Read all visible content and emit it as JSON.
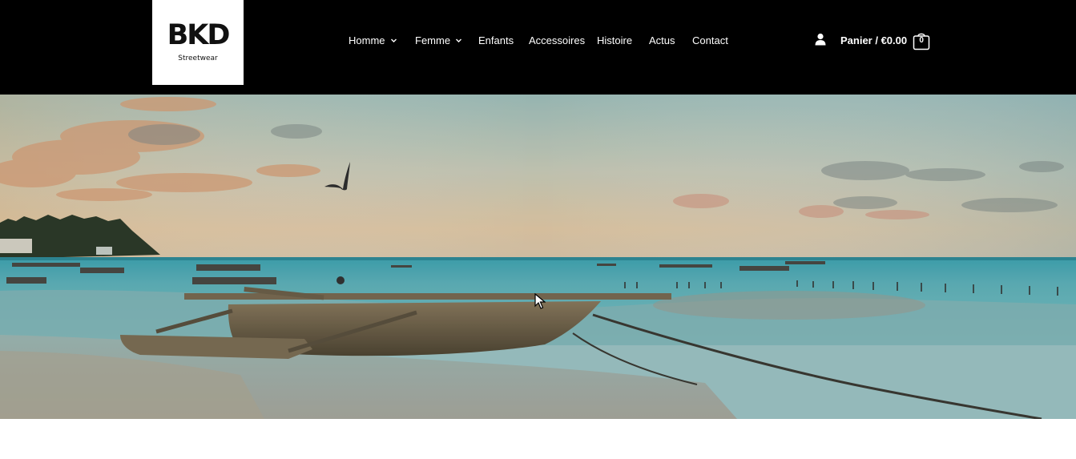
{
  "brand": {
    "logo_text": "BKD",
    "tagline": "Streetwear"
  },
  "nav": {
    "items": [
      {
        "label": "Homme",
        "has_dropdown": true
      },
      {
        "label": "Femme",
        "has_dropdown": true
      },
      {
        "label": "Enfants",
        "has_dropdown": false
      },
      {
        "label": "Accessoires",
        "has_dropdown": false
      },
      {
        "label": "Histoire",
        "has_dropdown": false
      },
      {
        "label": "Actus",
        "has_dropdown": false
      },
      {
        "label": "Contact",
        "has_dropdown": false
      }
    ]
  },
  "account": {
    "icon": "user-icon"
  },
  "cart": {
    "label": "Panier / €0.00",
    "count": "0",
    "icon": "shopping-bag-icon"
  },
  "hero": {
    "image": "beach-outrigger-canoe-at-dusk"
  },
  "colors": {
    "header_bg": "#000000",
    "nav_text": "#ffffff",
    "logo_bg": "#ffffff"
  }
}
